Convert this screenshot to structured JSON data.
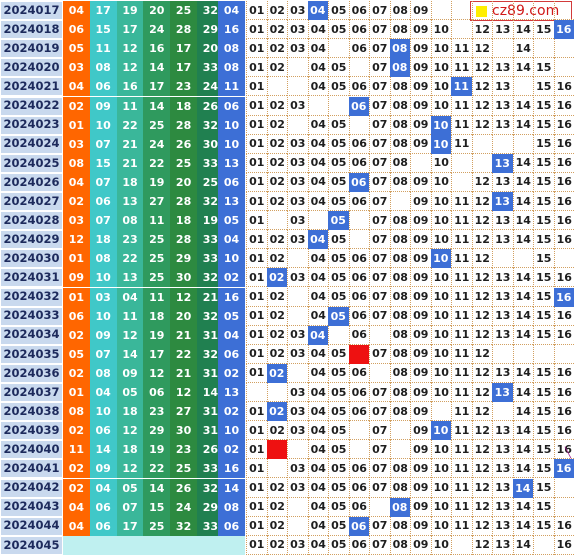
{
  "logo": {
    "text": "cz89.com"
  },
  "colors": {
    "period_bg": "#c9d9ee",
    "period_text": "#1d2a5c",
    "red_shades": [
      "#ff6600",
      "#40c8c8",
      "#3ab79a",
      "#2f9a5e",
      "#2d8a40",
      "#208050"
    ],
    "blue_ball_bg": "#3d6fd6",
    "hit_marker": "#3d6fd6",
    "special_red": "#ee1111"
  },
  "chart_data": {
    "type": "table",
    "columns": [
      "period",
      "red1",
      "red2",
      "red3",
      "red4",
      "red5",
      "red6",
      "blue",
      "01",
      "02",
      "03",
      "04",
      "05",
      "06",
      "07",
      "08",
      "09",
      "10",
      "11",
      "12",
      "13",
      "14",
      "15",
      "16"
    ],
    "rows": [
      {
        "period": "2024017",
        "reds": [
          "04",
          "17",
          "19",
          "20",
          "25",
          "32"
        ],
        "blue": "04",
        "cells": [
          "01",
          "02",
          "03",
          "HIT",
          "05",
          "06",
          "07",
          "08",
          "09",
          "",
          "",
          "",
          "",
          "",
          "",
          ""
        ]
      },
      {
        "period": "2024018",
        "reds": [
          "06",
          "15",
          "17",
          "24",
          "28",
          "29"
        ],
        "blue": "16",
        "cells": [
          "01",
          "02",
          "03",
          "04",
          "05",
          "06",
          "07",
          "08",
          "09",
          "10",
          "",
          "12",
          "13",
          "14",
          "15",
          "HIT"
        ]
      },
      {
        "period": "2024019",
        "reds": [
          "05",
          "11",
          "12",
          "16",
          "17",
          "20"
        ],
        "blue": "08",
        "cells": [
          "01",
          "02",
          "03",
          "04",
          "",
          "06",
          "07",
          "HIT",
          "09",
          "10",
          "11",
          "12",
          "",
          "14",
          "",
          ""
        ]
      },
      {
        "period": "2024020",
        "reds": [
          "03",
          "08",
          "12",
          "14",
          "17",
          "33"
        ],
        "blue": "08",
        "cells": [
          "01",
          "02",
          "",
          "04",
          "05",
          "",
          "07",
          "HIT",
          "09",
          "10",
          "11",
          "12",
          "13",
          "14",
          "15",
          ""
        ]
      },
      {
        "period": "2024021",
        "reds": [
          "04",
          "06",
          "16",
          "17",
          "23",
          "24"
        ],
        "blue": "11",
        "cells": [
          "01",
          "",
          "",
          "04",
          "05",
          "06",
          "07",
          "08",
          "09",
          "10",
          "HIT",
          "12",
          "13",
          "",
          "15",
          "16"
        ]
      },
      {
        "period": "2024022",
        "reds": [
          "02",
          "09",
          "11",
          "14",
          "18",
          "26"
        ],
        "blue": "06",
        "cells": [
          "01",
          "02",
          "03",
          "",
          "",
          "HIT",
          "07",
          "08",
          "09",
          "10",
          "11",
          "12",
          "13",
          "14",
          "15",
          "16"
        ]
      },
      {
        "period": "2024023",
        "reds": [
          "01",
          "10",
          "22",
          "25",
          "28",
          "32"
        ],
        "blue": "10",
        "cells": [
          "01",
          "02",
          "",
          "04",
          "05",
          "",
          "07",
          "08",
          "09",
          "HIT",
          "11",
          "12",
          "13",
          "14",
          "15",
          "16"
        ]
      },
      {
        "period": "2024024",
        "reds": [
          "03",
          "07",
          "21",
          "24",
          "26",
          "30"
        ],
        "blue": "10",
        "cells": [
          "01",
          "02",
          "03",
          "04",
          "05",
          "06",
          "07",
          "08",
          "09",
          "HIT",
          "11",
          "",
          "",
          "",
          "15",
          "16"
        ]
      },
      {
        "period": "2024025",
        "reds": [
          "08",
          "15",
          "21",
          "22",
          "25",
          "33"
        ],
        "blue": "13",
        "cells": [
          "01",
          "02",
          "03",
          "04",
          "05",
          "06",
          "07",
          "08",
          "",
          "10",
          "",
          "",
          "HIT",
          "14",
          "15",
          "16"
        ]
      },
      {
        "period": "2024026",
        "reds": [
          "04",
          "07",
          "18",
          "19",
          "20",
          "25"
        ],
        "blue": "06",
        "cells": [
          "01",
          "02",
          "03",
          "04",
          "05",
          "HIT",
          "07",
          "08",
          "09",
          "10",
          "",
          "12",
          "13",
          "14",
          "15",
          "16"
        ]
      },
      {
        "period": "2024027",
        "reds": [
          "02",
          "06",
          "13",
          "27",
          "28",
          "32"
        ],
        "blue": "13",
        "cells": [
          "01",
          "02",
          "03",
          "04",
          "05",
          "06",
          "07",
          "",
          "09",
          "10",
          "11",
          "12",
          "HIT",
          "14",
          "15",
          "16"
        ]
      },
      {
        "period": "2024028",
        "reds": [
          "03",
          "07",
          "08",
          "11",
          "18",
          "19"
        ],
        "blue": "05",
        "cells": [
          "01",
          "",
          "03",
          "",
          "HIT",
          "",
          "07",
          "08",
          "09",
          "10",
          "11",
          "12",
          "13",
          "14",
          "15",
          "16"
        ]
      },
      {
        "period": "2024029",
        "reds": [
          "12",
          "18",
          "23",
          "25",
          "28",
          "33"
        ],
        "blue": "04",
        "cells": [
          "01",
          "02",
          "03",
          "HIT",
          "05",
          "",
          "07",
          "08",
          "09",
          "10",
          "11",
          "12",
          "13",
          "14",
          "15",
          "16"
        ]
      },
      {
        "period": "2024030",
        "reds": [
          "01",
          "08",
          "22",
          "25",
          "29",
          "33"
        ],
        "blue": "10",
        "cells": [
          "01",
          "02",
          "",
          "04",
          "05",
          "06",
          "07",
          "08",
          "09",
          "HIT",
          "11",
          "12",
          "",
          "",
          "15",
          ""
        ]
      },
      {
        "period": "2024031",
        "reds": [
          "09",
          "10",
          "13",
          "25",
          "30",
          "32"
        ],
        "blue": "02",
        "cells": [
          "01",
          "HIT",
          "03",
          "04",
          "05",
          "06",
          "07",
          "08",
          "09",
          "10",
          "11",
          "12",
          "13",
          "14",
          "15",
          "16"
        ]
      },
      {
        "period": "2024032",
        "reds": [
          "01",
          "03",
          "04",
          "11",
          "12",
          "21"
        ],
        "blue": "16",
        "cells": [
          "01",
          "02",
          "",
          "04",
          "05",
          "06",
          "07",
          "08",
          "09",
          "10",
          "11",
          "12",
          "13",
          "14",
          "15",
          "HIT"
        ]
      },
      {
        "period": "2024033",
        "reds": [
          "06",
          "10",
          "11",
          "18",
          "20",
          "32"
        ],
        "blue": "05",
        "cells": [
          "01",
          "02",
          "",
          "04",
          "HIT",
          "06",
          "07",
          "08",
          "09",
          "10",
          "11",
          "12",
          "13",
          "14",
          "15",
          "16"
        ]
      },
      {
        "period": "2024034",
        "reds": [
          "02",
          "09",
          "12",
          "19",
          "21",
          "31"
        ],
        "blue": "04",
        "cells": [
          "01",
          "02",
          "03",
          "HIT",
          "",
          "06",
          "",
          "08",
          "09",
          "10",
          "11",
          "12",
          "13",
          "14",
          "15",
          "16"
        ]
      },
      {
        "period": "2024035",
        "reds": [
          "05",
          "07",
          "14",
          "17",
          "22",
          "32"
        ],
        "blue": "06",
        "cells": [
          "01",
          "02",
          "03",
          "04",
          "05",
          "RED",
          "07",
          "08",
          "09",
          "10",
          "11",
          "12",
          "",
          "",
          "",
          ""
        ]
      },
      {
        "period": "2024036",
        "reds": [
          "02",
          "08",
          "09",
          "12",
          "21",
          "31"
        ],
        "blue": "02",
        "cells": [
          "01",
          "HIT",
          "",
          "04",
          "05",
          "06",
          "",
          "08",
          "09",
          "10",
          "11",
          "12",
          "13",
          "14",
          "15",
          "16"
        ]
      },
      {
        "period": "2024037",
        "reds": [
          "01",
          "04",
          "05",
          "06",
          "12",
          "14"
        ],
        "blue": "13",
        "cells": [
          "",
          "",
          "03",
          "04",
          "05",
          "06",
          "07",
          "08",
          "09",
          "10",
          "11",
          "12",
          "HIT",
          "14",
          "15",
          "16"
        ]
      },
      {
        "period": "2024038",
        "reds": [
          "08",
          "10",
          "18",
          "23",
          "27",
          "31"
        ],
        "blue": "02",
        "cells": [
          "01",
          "HIT",
          "03",
          "04",
          "05",
          "06",
          "07",
          "08",
          "09",
          "",
          "11",
          "12",
          "",
          "14",
          "15",
          "16"
        ]
      },
      {
        "period": "2024039",
        "reds": [
          "02",
          "06",
          "12",
          "29",
          "30",
          "31"
        ],
        "blue": "10",
        "cells": [
          "01",
          "02",
          "03",
          "04",
          "05",
          "",
          "07",
          "",
          "09",
          "HIT",
          "11",
          "12",
          "13",
          "14",
          "15",
          "16"
        ]
      },
      {
        "period": "2024040",
        "reds": [
          "11",
          "14",
          "18",
          "19",
          "23",
          "26"
        ],
        "blue": "02",
        "cells": [
          "01",
          "RED",
          "",
          "04",
          "05",
          "",
          "07",
          "",
          "09",
          "10",
          "11",
          "12",
          "13",
          "14",
          "15",
          "16"
        ]
      },
      {
        "period": "2024041",
        "reds": [
          "02",
          "09",
          "12",
          "22",
          "25",
          "33"
        ],
        "blue": "16",
        "cells": [
          "01",
          "",
          "03",
          "04",
          "05",
          "06",
          "07",
          "08",
          "09",
          "10",
          "11",
          "12",
          "13",
          "14",
          "15",
          "HIT"
        ]
      },
      {
        "period": "2024042",
        "reds": [
          "02",
          "04",
          "05",
          "14",
          "26",
          "32"
        ],
        "blue": "14",
        "cells": [
          "01",
          "02",
          "03",
          "04",
          "05",
          "06",
          "07",
          "08",
          "09",
          "10",
          "11",
          "12",
          "13",
          "HIT",
          "15",
          ""
        ]
      },
      {
        "period": "2024043",
        "reds": [
          "04",
          "06",
          "07",
          "15",
          "24",
          "29"
        ],
        "blue": "08",
        "cells": [
          "01",
          "02",
          "",
          "04",
          "05",
          "06",
          "",
          "HIT",
          "09",
          "10",
          "11",
          "12",
          "13",
          "14",
          "15",
          ""
        ]
      },
      {
        "period": "2024044",
        "reds": [
          "04",
          "06",
          "17",
          "25",
          "32",
          "33"
        ],
        "blue": "06",
        "cells": [
          "01",
          "02",
          "",
          "04",
          "05",
          "HIT",
          "07",
          "08",
          "09",
          "10",
          "11",
          "12",
          "13",
          "14",
          "15",
          "16"
        ]
      },
      {
        "period": "2024045",
        "reds": [
          "",
          "",
          "",
          "",
          "",
          ""
        ],
        "blue": "",
        "cells": [
          "01",
          "02",
          "03",
          "04",
          "05",
          "06",
          "07",
          "08",
          "09",
          "10",
          "",
          "12",
          "13",
          "14",
          "",
          "16"
        ]
      }
    ]
  }
}
